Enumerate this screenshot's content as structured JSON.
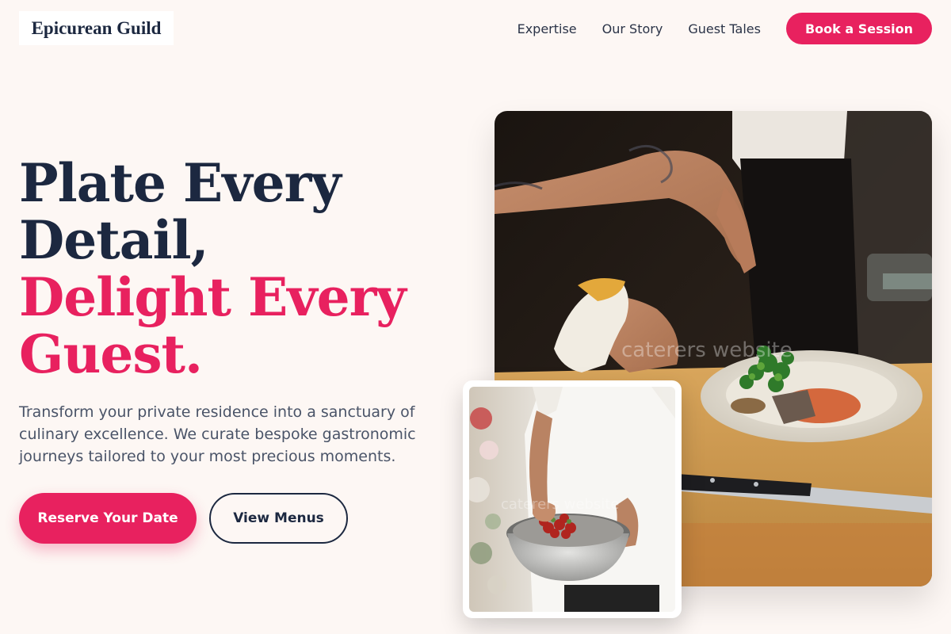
{
  "brand": {
    "name": "Epicurean Guild"
  },
  "nav": {
    "links": [
      "Expertise",
      "Our Story",
      "Guest Tales"
    ],
    "cta": "Book a Session"
  },
  "hero": {
    "headline_line1": "Plate Every",
    "headline_line2": "Detail,",
    "headline_accent_line1": "Delight Every",
    "headline_accent_line2": "Guest.",
    "lead": "Transform your private residence into a sanctuary of culinary excellence. We curate bespoke gastronomic journeys tailored to your most precious moments.",
    "primary_button": "Reserve Your Date",
    "secondary_button": "View Menus"
  },
  "images": {
    "watermark_text": "caterers website"
  },
  "colors": {
    "accent": "#e8215f",
    "navy": "#1c2840",
    "background": "#fdf7f4"
  }
}
